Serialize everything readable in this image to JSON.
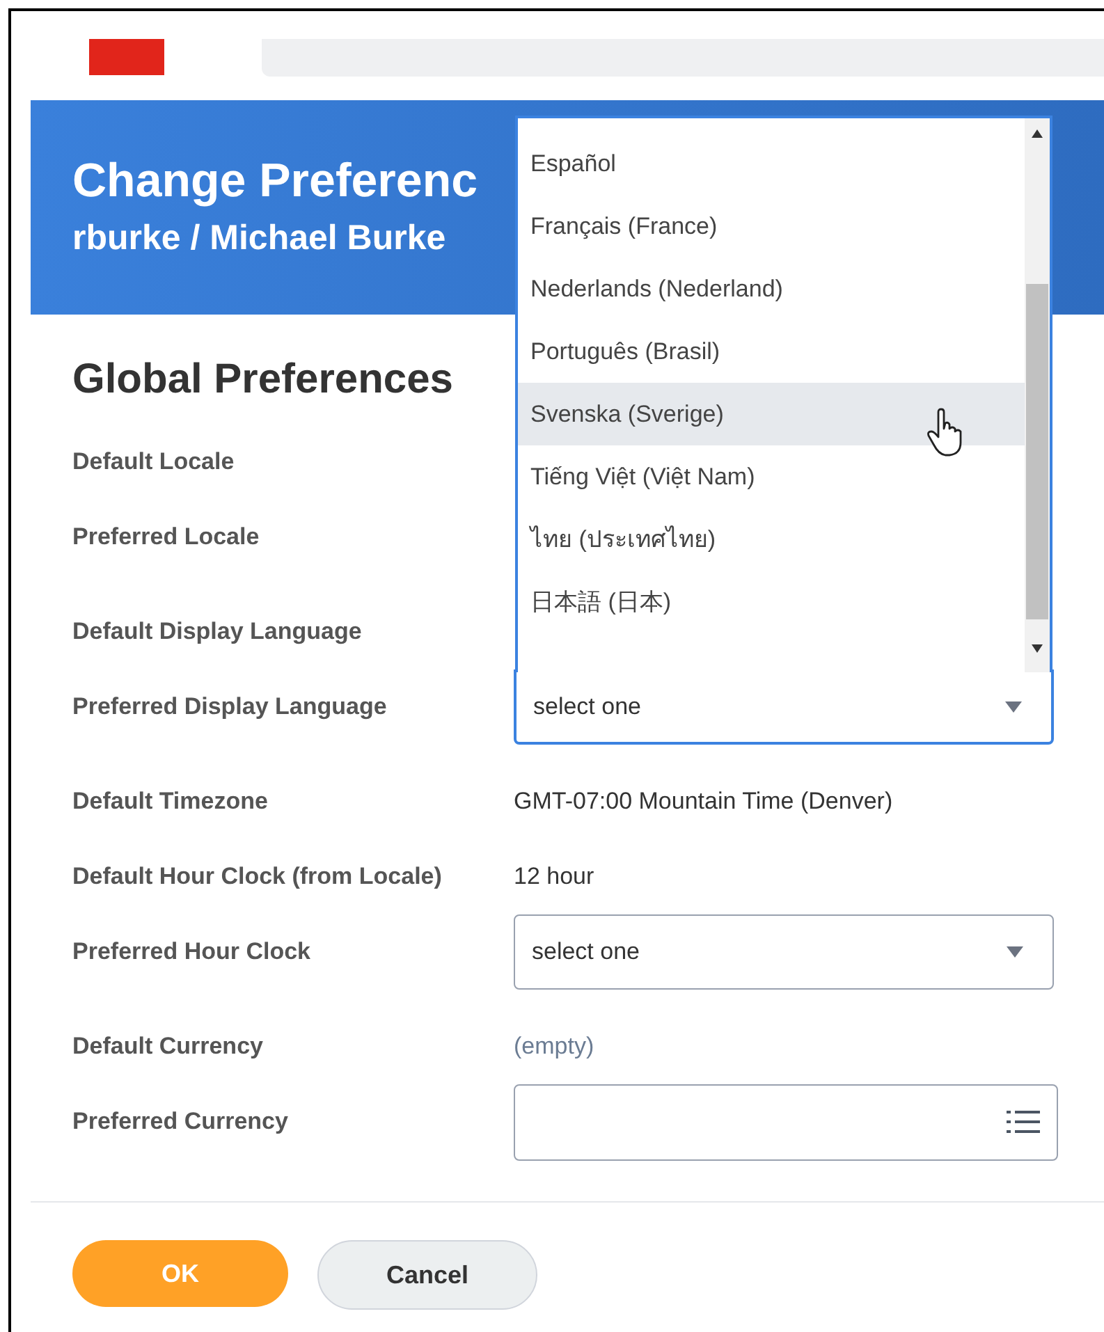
{
  "header": {
    "title": "Change Preferenc",
    "subtitle": "rburke / Michael Burke"
  },
  "section": {
    "title": "Global Preferences"
  },
  "rows": [
    {
      "label": "Default Locale",
      "kind": "blank"
    },
    {
      "label": "Preferred Locale",
      "kind": "blank"
    },
    {
      "label": "Default Display Language",
      "kind": "blank"
    },
    {
      "label": "Preferred Display Language",
      "kind": "select",
      "placeholder": "select one",
      "focused": true
    },
    {
      "label": "Default Timezone",
      "kind": "text",
      "value": "GMT-07:00 Mountain Time (Denver)"
    },
    {
      "label": "Default Hour Clock (from Locale)",
      "kind": "text",
      "value": "12 hour"
    },
    {
      "label": "Preferred Hour Clock",
      "kind": "select",
      "placeholder": "select one",
      "focused": false
    },
    {
      "label": "Default Currency",
      "kind": "empty",
      "value": "(empty)"
    },
    {
      "label": "Preferred Currency",
      "kind": "prompt"
    }
  ],
  "dropdown": {
    "options": [
      {
        "label": "Español",
        "highlighted": false
      },
      {
        "label": "Français (France)",
        "highlighted": false
      },
      {
        "label": "Nederlands (Nederland)",
        "highlighted": false
      },
      {
        "label": "Português (Brasil)",
        "highlighted": false
      },
      {
        "label": "Svenska (Sverige)",
        "highlighted": true
      },
      {
        "label": "Tiếng Việt (Việt Nam)",
        "highlighted": false
      },
      {
        "label": "ไทย (ประเทศไทย)",
        "highlighted": false
      },
      {
        "label": "日本語 (日本)",
        "highlighted": false
      }
    ]
  },
  "buttons": [
    {
      "label": "OK",
      "kind": "primary"
    },
    {
      "label": "Cancel",
      "kind": "secondary"
    }
  ]
}
